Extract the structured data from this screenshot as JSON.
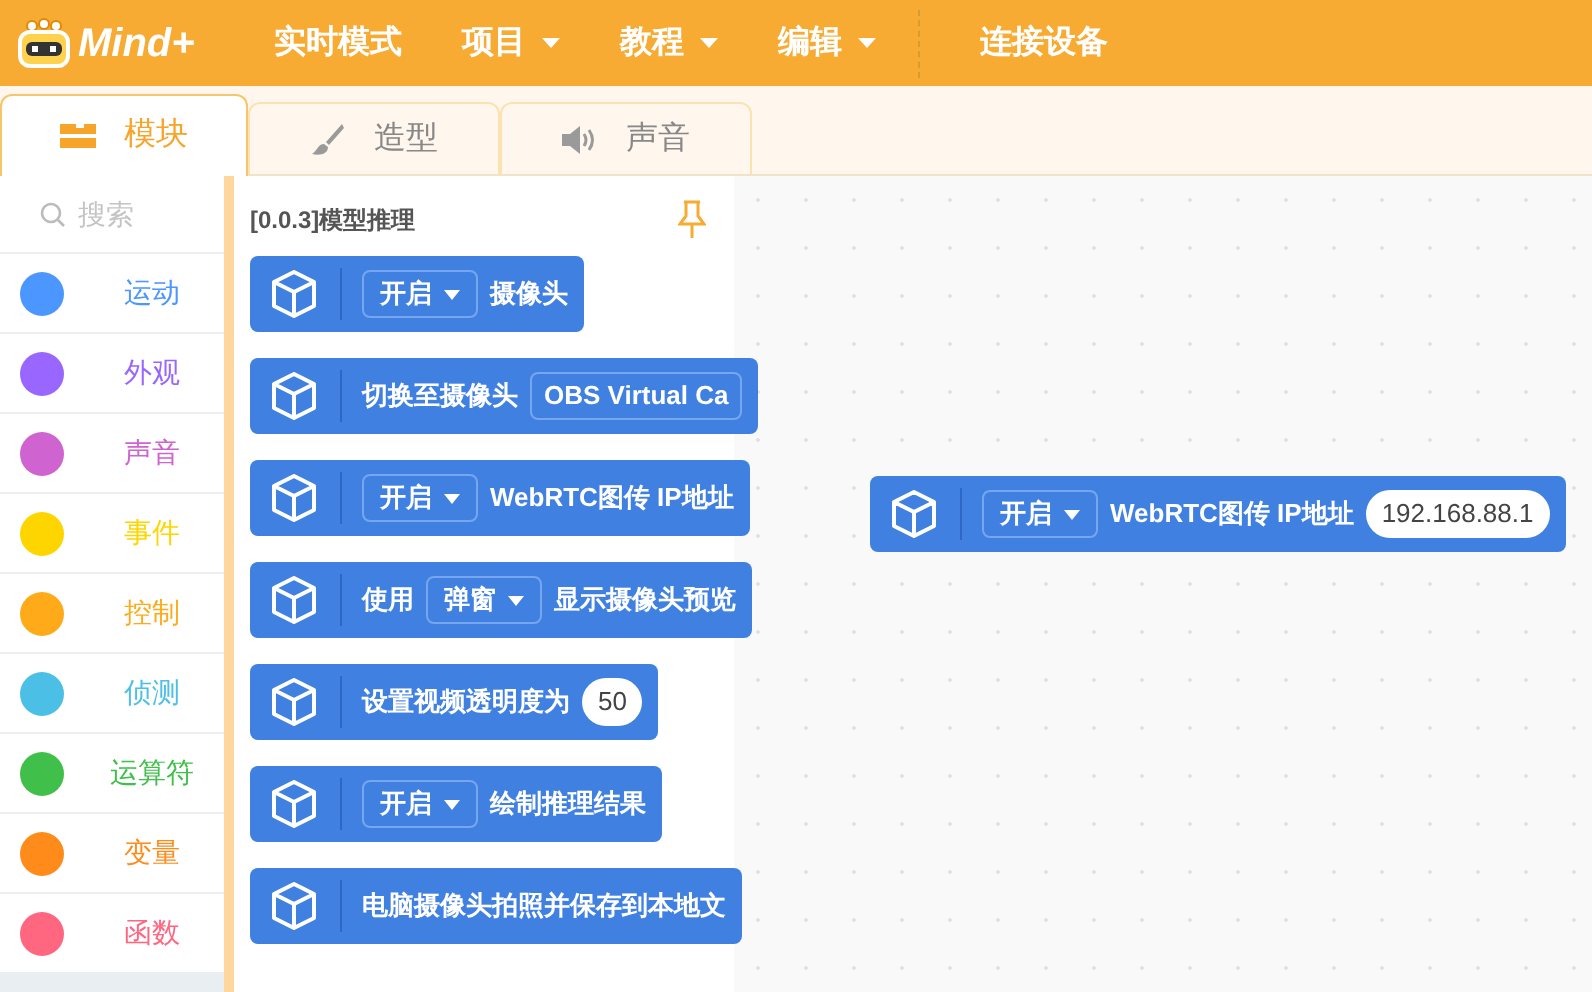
{
  "menu_bar": {
    "logo": "Mind+",
    "items": [
      {
        "label": "实时模式",
        "dropdown": false
      },
      {
        "label": "项目",
        "dropdown": true
      },
      {
        "label": "教程",
        "dropdown": true
      },
      {
        "label": "编辑",
        "dropdown": true
      }
    ],
    "connect": "连接设备"
  },
  "tabs": [
    {
      "label": "模块",
      "selected": true
    },
    {
      "label": "造型",
      "selected": false
    },
    {
      "label": "声音",
      "selected": false
    }
  ],
  "search": {
    "placeholder": "搜索"
  },
  "categories": [
    {
      "label": "运动",
      "color": "#4c97ff"
    },
    {
      "label": "外观",
      "color": "#9966ff"
    },
    {
      "label": "声音",
      "color": "#cf63cf"
    },
    {
      "label": "事件",
      "color": "#ffd500"
    },
    {
      "label": "控制",
      "color": "#ffab19"
    },
    {
      "label": "侦测",
      "color": "#4cbfe6"
    },
    {
      "label": "运算符",
      "color": "#40bf4a"
    },
    {
      "label": "变量",
      "color": "#ff8c1a"
    },
    {
      "label": "函数",
      "color": "#ff6680"
    }
  ],
  "palette": {
    "title": "[0.0.3]模型推理",
    "blocks": [
      {
        "parts": [
          {
            "kind": "dropdown",
            "text": "开启"
          },
          {
            "kind": "text",
            "text": "摄像头"
          }
        ]
      },
      {
        "parts": [
          {
            "kind": "text",
            "text": "切换至摄像头"
          },
          {
            "kind": "field",
            "text": "OBS Virtual Ca"
          }
        ]
      },
      {
        "parts": [
          {
            "kind": "dropdown",
            "text": "开启"
          },
          {
            "kind": "text",
            "text": "WebRTC图传 IP地址"
          }
        ]
      },
      {
        "parts": [
          {
            "kind": "text",
            "text": "使用"
          },
          {
            "kind": "dropdown",
            "text": "弹窗"
          },
          {
            "kind": "text",
            "text": "显示摄像头预览"
          }
        ]
      },
      {
        "parts": [
          {
            "kind": "text",
            "text": "设置视频透明度为"
          },
          {
            "kind": "value",
            "text": "50"
          }
        ]
      },
      {
        "parts": [
          {
            "kind": "dropdown",
            "text": "开启"
          },
          {
            "kind": "text",
            "text": "绘制推理结果"
          }
        ]
      },
      {
        "parts": [
          {
            "kind": "text",
            "text": "电脑摄像头拍照并保存到本地文"
          }
        ]
      }
    ]
  },
  "workspace": {
    "blocks": [
      {
        "parts": [
          {
            "kind": "dropdown",
            "text": "开启"
          },
          {
            "kind": "text",
            "text": "WebRTC图传 IP地址"
          },
          {
            "kind": "value",
            "text": "192.168.88.1"
          }
        ]
      }
    ]
  }
}
